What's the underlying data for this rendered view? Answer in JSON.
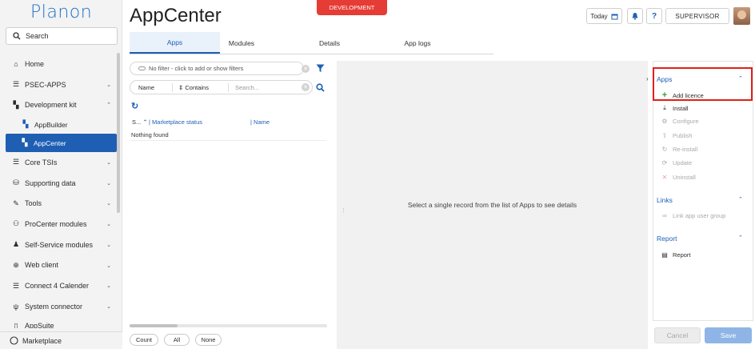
{
  "sidebar": {
    "logo": "Planon",
    "search_label": "Search",
    "items": [
      {
        "label": "Home",
        "icon": "home-icon",
        "chevron": ""
      },
      {
        "label": "PSEC-APPS",
        "icon": "list-icon",
        "chevron": "⌄"
      },
      {
        "label": "Development kit",
        "icon": "grid-icon",
        "chevron": "⌃"
      },
      {
        "label": "AppBuilder",
        "icon": "grid-icon",
        "chevron": ""
      },
      {
        "label": "AppCenter",
        "icon": "grid-icon",
        "chevron": ""
      },
      {
        "label": "Core TSIs",
        "icon": "list-icon",
        "chevron": "⌄"
      },
      {
        "label": "Supporting data",
        "icon": "database-icon",
        "chevron": "⌄"
      },
      {
        "label": "Tools",
        "icon": "wrench-icon",
        "chevron": "⌄"
      },
      {
        "label": "ProCenter modules",
        "icon": "user-cog-icon",
        "chevron": "⌄"
      },
      {
        "label": "Self-Service modules",
        "icon": "person-icon",
        "chevron": "⌄"
      },
      {
        "label": "Web client",
        "icon": "globe-icon",
        "chevron": "⌄"
      },
      {
        "label": "Connect 4 Calender",
        "icon": "list-icon",
        "chevron": "⌄"
      },
      {
        "label": "System connector",
        "icon": "plug-icon",
        "chevron": "⌄"
      },
      {
        "label": "AppSuite",
        "icon": "box-icon",
        "chevron": "⌄"
      }
    ],
    "marketplace_label": "Marketplace"
  },
  "header": {
    "title": "AppCenter",
    "env_badge": "DEVELOPMENT",
    "today_label": "Today",
    "user_label": "SUPERVISOR"
  },
  "tabs": [
    "Apps",
    "Modules",
    "Details",
    "App logs"
  ],
  "list": {
    "filter_text": "No filter - click to add or show filters",
    "search_field": "Name",
    "search_operator": "Contains",
    "search_placeholder": "Search...",
    "columns": [
      "S...",
      "Marketplace status",
      "Name"
    ],
    "empty_text": "Nothing found",
    "footer_buttons": [
      "Count",
      "All",
      "None"
    ]
  },
  "detail": {
    "message": "Select a single record from the list of Apps to see details"
  },
  "actions": {
    "sections": [
      {
        "title": "Apps",
        "items": [
          {
            "label": "Add licence",
            "enabled": true
          },
          {
            "label": "Install",
            "enabled": true
          },
          {
            "label": "Configure",
            "enabled": false
          },
          {
            "label": "Publish",
            "enabled": false
          },
          {
            "label": "Re-install",
            "enabled": false
          },
          {
            "label": "Update",
            "enabled": false
          },
          {
            "label": "Uninstall",
            "enabled": false
          }
        ]
      },
      {
        "title": "Links",
        "items": [
          {
            "label": "Link app user group",
            "enabled": false
          }
        ]
      },
      {
        "title": "Report",
        "items": [
          {
            "label": "Report",
            "enabled": true
          }
        ]
      }
    ],
    "cancel_label": "Cancel",
    "save_label": "Save"
  },
  "colors": {
    "brand_blue": "#1e5fb4",
    "dev_red": "#e53c35",
    "highlight_red": "#e0201a",
    "add_green": "#3a9a3a"
  }
}
